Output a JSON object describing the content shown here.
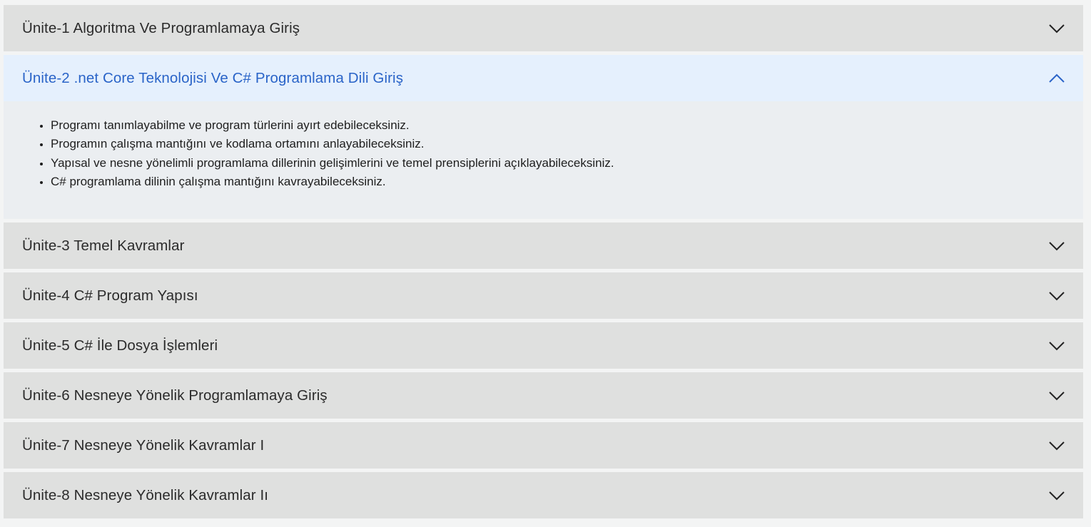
{
  "colors": {
    "header_bg": "#dfe0df",
    "open_header_bg": "#e5f0fd",
    "open_title": "#2a64c8",
    "body_bg": "#ebeef1",
    "page_bg": "#f3f4f4"
  },
  "units": [
    {
      "title": "Ünite-1 Algoritma Ve Programlamaya Giriş",
      "expanded": false,
      "icon": "chevron-down-icon"
    },
    {
      "title": "Ünite-2 .net Core Teknolojisi Ve C# Programlama Dili Giriş",
      "expanded": true,
      "icon": "chevron-up-icon",
      "outcomes": [
        "Programı tanımlayabilme ve program türlerini ayırt edebileceksiniz.",
        "Programın çalışma mantığını ve kodlama ortamını anlayabileceksiniz.",
        "Yapısal ve nesne yönelimli programlama dillerinin gelişimlerini ve temel prensiplerini açıklayabileceksiniz.",
        "C# programlama dilinin çalışma mantığını kavrayabileceksiniz."
      ]
    },
    {
      "title": "Ünite-3 Temel Kavramlar",
      "expanded": false,
      "icon": "chevron-down-icon"
    },
    {
      "title": "Ünite-4 C# Program Yapısı",
      "expanded": false,
      "icon": "chevron-down-icon"
    },
    {
      "title": "Ünite-5 C# İle Dosya İşlemleri",
      "expanded": false,
      "icon": "chevron-down-icon"
    },
    {
      "title": "Ünite-6 Nesneye Yönelik Programlamaya Giriş",
      "expanded": false,
      "icon": "chevron-down-icon"
    },
    {
      "title": "Ünite-7 Nesneye Yönelik Kavramlar I",
      "expanded": false,
      "icon": "chevron-down-icon"
    },
    {
      "title": "Ünite-8 Nesneye Yönelik Kavramlar Iı",
      "expanded": false,
      "icon": "chevron-down-icon"
    }
  ]
}
